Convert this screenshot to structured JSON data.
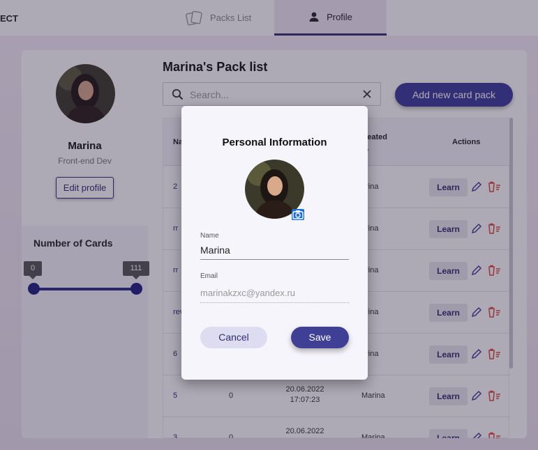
{
  "header": {
    "brand": "ECT",
    "tabs": [
      {
        "label": "Packs List",
        "icon": "cards-icon"
      },
      {
        "label": "Profile",
        "icon": "person-icon"
      }
    ]
  },
  "sidebar": {
    "name": "Marina",
    "role": "Front-end Dev",
    "edit_label": "Edit profile",
    "cards_label": "Number of Cards",
    "range_min": "0",
    "range_max": "111"
  },
  "main": {
    "title": "Marina's Pack list",
    "search_placeholder": "Search...",
    "add_label": "Add new card pack",
    "columns": [
      "Na",
      "reated\ny",
      "Actions"
    ],
    "rows": [
      {
        "name": "2",
        "cards": "",
        "updated": "",
        "creator": "arina"
      },
      {
        "name": "rr",
        "cards": "",
        "updated": "",
        "creator": "arina"
      },
      {
        "name": "rr",
        "cards": "",
        "updated": "",
        "creator": "arina"
      },
      {
        "name": "rev",
        "cards": "",
        "updated": "",
        "creator": "arina"
      },
      {
        "name": "6",
        "cards": "",
        "updated": "",
        "creator": "arina"
      },
      {
        "name": "5",
        "cards": "0",
        "updated": "20.06.2022\n17:07:23",
        "creator": "Marina"
      },
      {
        "name": "3",
        "cards": "0",
        "updated": "20.06.2022",
        "creator": "Marina"
      }
    ],
    "learn_label": "Learn"
  },
  "modal": {
    "title": "Personal Information",
    "name_label": "Name",
    "name_value": "Marina",
    "email_label": "Email",
    "email_value": "marinakzxc@yandex.ru",
    "cancel_label": "Cancel",
    "save_label": "Save"
  },
  "colors": {
    "accent": "#3f3f96",
    "delete": "#e0453a",
    "camera": "#1f6fd0"
  }
}
